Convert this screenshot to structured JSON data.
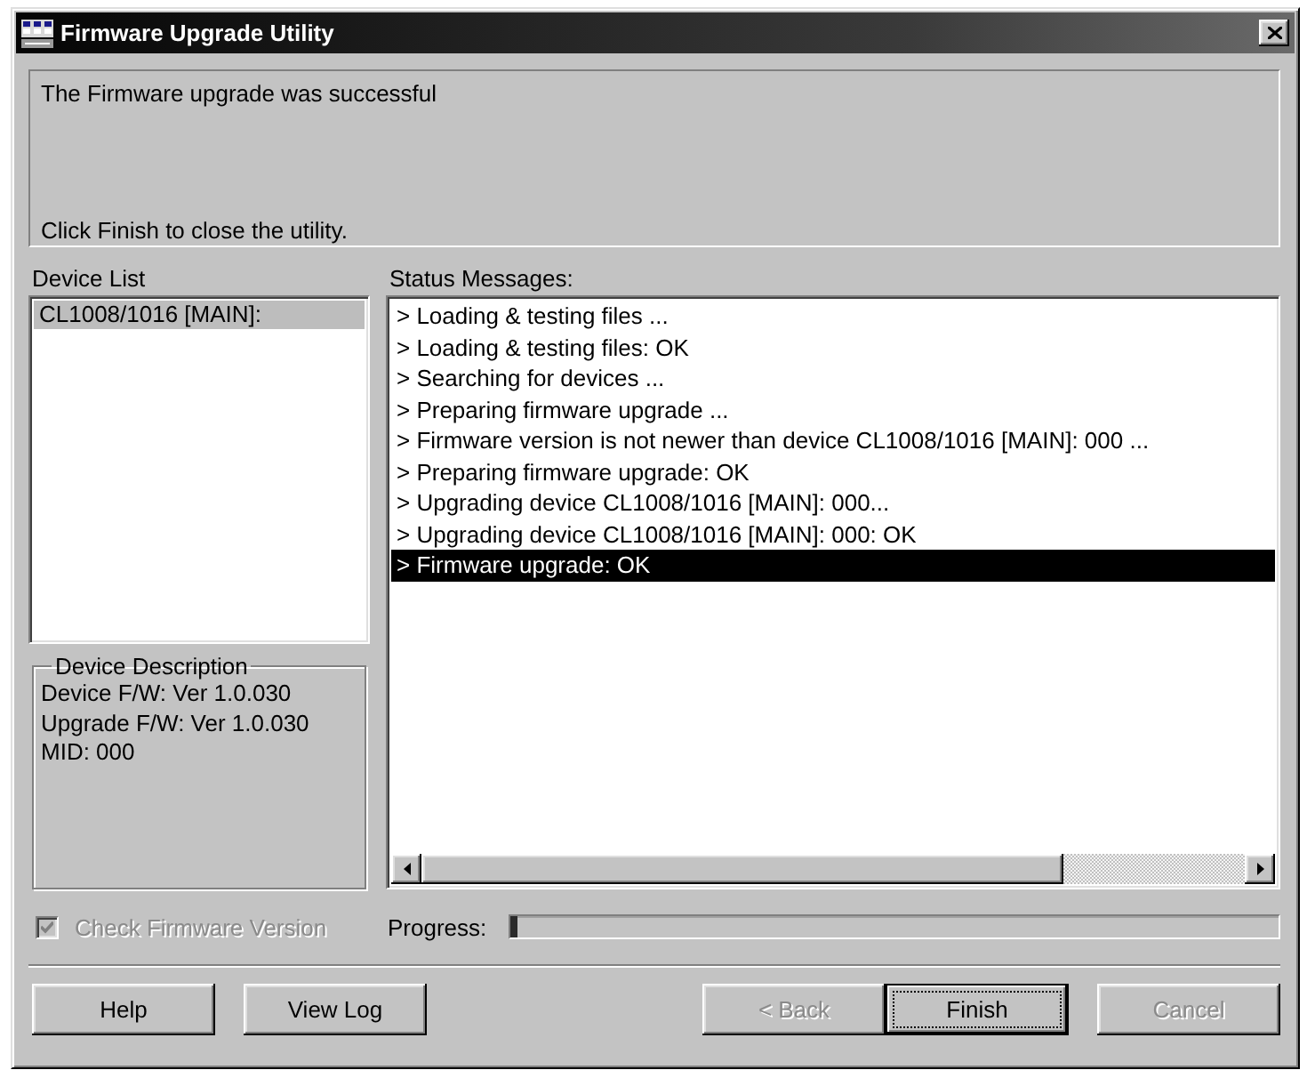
{
  "window": {
    "title": "Firmware Upgrade Utility"
  },
  "message_panel": {
    "message": "The Firmware upgrade was successful",
    "instruction": "Click Finish to close the utility."
  },
  "device_list": {
    "label": "Device List",
    "items": [
      {
        "label": "CL1008/1016 [MAIN]:",
        "selected": true
      }
    ]
  },
  "device_description": {
    "title": "Device Description",
    "lines": [
      "Device F/W: Ver 1.0.030",
      "Upgrade F/W: Ver 1.0.030",
      "MID: 000"
    ]
  },
  "status_messages": {
    "label": "Status Messages:",
    "items": [
      {
        "text": "> Loading & testing files ...",
        "selected": false
      },
      {
        "text": "> Loading & testing files: OK",
        "selected": false
      },
      {
        "text": "> Searching for devices ...",
        "selected": false
      },
      {
        "text": "> Preparing firmware upgrade ...",
        "selected": false
      },
      {
        "text": "> Firmware version is not newer than device CL1008/1016 [MAIN]: 000 ...",
        "selected": false
      },
      {
        "text": "> Preparing firmware upgrade: OK",
        "selected": false
      },
      {
        "text": "> Upgrading device CL1008/1016 [MAIN]: 000...",
        "selected": false
      },
      {
        "text": "> Upgrading device CL1008/1016 [MAIN]: 000: OK",
        "selected": false
      },
      {
        "text": "> Firmware upgrade: OK",
        "selected": true
      }
    ]
  },
  "check_firmware_version": {
    "label": "Check Firmware Version",
    "checked": true,
    "disabled": true
  },
  "progress": {
    "label": "Progress:",
    "level": 0.01
  },
  "buttons": [
    {
      "label": "Help",
      "disabled": false,
      "focused": false
    },
    {
      "label": "View Log",
      "disabled": false,
      "focused": false
    },
    {
      "label": "< Back",
      "disabled": true,
      "focused": false
    },
    {
      "label": "Finish",
      "disabled": false,
      "focused": true
    },
    {
      "label": "Cancel",
      "disabled": true,
      "focused": false
    }
  ]
}
